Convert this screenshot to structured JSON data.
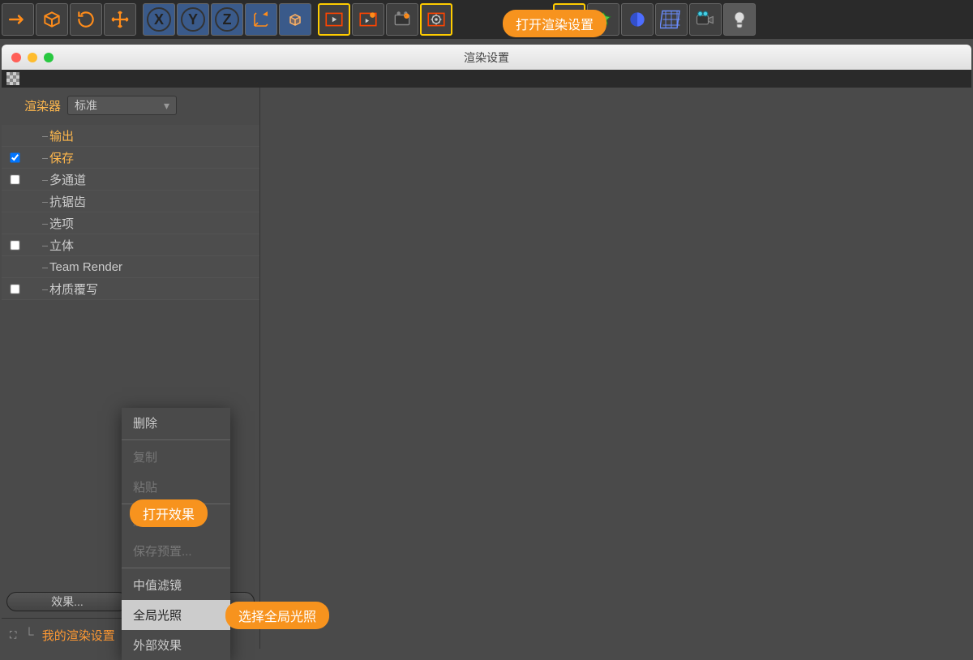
{
  "callouts": {
    "open_render_settings": "打开渲染设置",
    "open_effects": "打开效果",
    "select_gi": "选择全局光照"
  },
  "window": {
    "title": "渲染设置"
  },
  "sidebar": {
    "renderer_label": "渲染器",
    "renderer_value": "标准",
    "tree": {
      "output": "输出",
      "save": "保存",
      "multipass": "多通道",
      "antialias": "抗锯齿",
      "options": "选项",
      "stereo": "立体",
      "team_render": "Team Render",
      "material_override": "材质覆写"
    },
    "effects_btn": "效果...",
    "preset_label": "我的渲染设置"
  },
  "ctx": {
    "delete": "删除",
    "copy": "复制",
    "paste": "粘贴",
    "save_preset": "保存预置...",
    "median_filter": "中值滤镜",
    "gi": "全局光照",
    "external_fx": "外部效果"
  }
}
